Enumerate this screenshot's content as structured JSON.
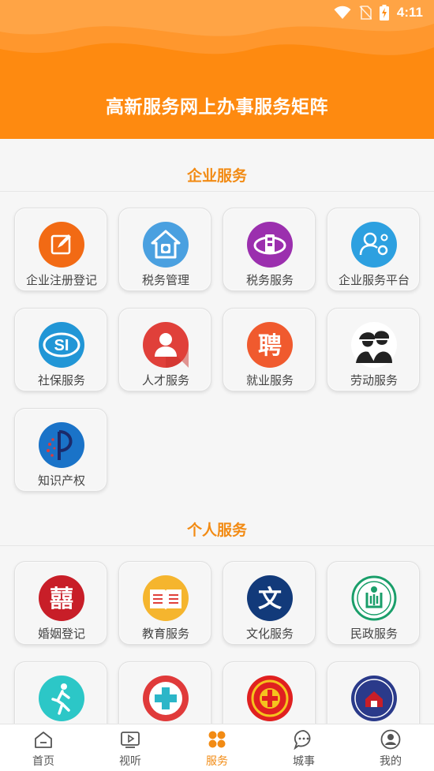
{
  "status_bar": {
    "time": "4:11"
  },
  "header": {
    "title": "高新服务网上办事服务矩阵"
  },
  "sections": [
    {
      "title": "企业服务",
      "items": [
        {
          "label": "企业注册登记",
          "icon": "pencil-edit-icon",
          "color": "#f26a14"
        },
        {
          "label": "税务管理",
          "icon": "tax-house-icon",
          "color": "#4aa0e0"
        },
        {
          "label": "税务服务",
          "icon": "tax-emblem-icon",
          "color": "#9b2fae"
        },
        {
          "label": "企业服务平台",
          "icon": "user-gears-icon",
          "color": "#2da0e0"
        },
        {
          "label": "社保服务",
          "icon": "social-security-icon",
          "color": "#2196d6"
        },
        {
          "label": "人才服务",
          "icon": "person-icon",
          "color": "#e0403a"
        },
        {
          "label": "就业服务",
          "icon": "hire-icon",
          "color": "#f05a2e"
        },
        {
          "label": "劳动服务",
          "icon": "workers-icon",
          "color": "#ffffff"
        },
        {
          "label": "知识产权",
          "icon": "ip-icon",
          "color": "#1a73c8"
        }
      ]
    },
    {
      "title": "个人服务",
      "items": [
        {
          "label": "婚姻登记",
          "icon": "double-happiness-icon",
          "color": "#c81e28"
        },
        {
          "label": "教育服务",
          "icon": "book-icon",
          "color": "#f5b52e"
        },
        {
          "label": "文化服务",
          "icon": "culture-icon",
          "color": "#123a7a"
        },
        {
          "label": "民政服务",
          "icon": "civil-affairs-icon",
          "color": "#1a9e6a"
        },
        {
          "label": "",
          "icon": "running-icon",
          "color": "#2cc7c7"
        },
        {
          "label": "",
          "icon": "medical-cross-icon",
          "color": "#e03a3a"
        },
        {
          "label": "",
          "icon": "trade-union-icon",
          "color": "#e02020"
        },
        {
          "label": "",
          "icon": "real-estate-icon",
          "color": "#2a3a8a"
        }
      ]
    }
  ],
  "tabs": [
    {
      "label": "首页",
      "icon": "home-icon",
      "active": false
    },
    {
      "label": "视听",
      "icon": "video-icon",
      "active": false
    },
    {
      "label": "服务",
      "icon": "services-icon",
      "active": true
    },
    {
      "label": "城事",
      "icon": "chat-icon",
      "active": false
    },
    {
      "label": "我的",
      "icon": "profile-icon",
      "active": false
    }
  ],
  "colors": {
    "header": "#fe8a10",
    "accent": "#f28b14"
  }
}
